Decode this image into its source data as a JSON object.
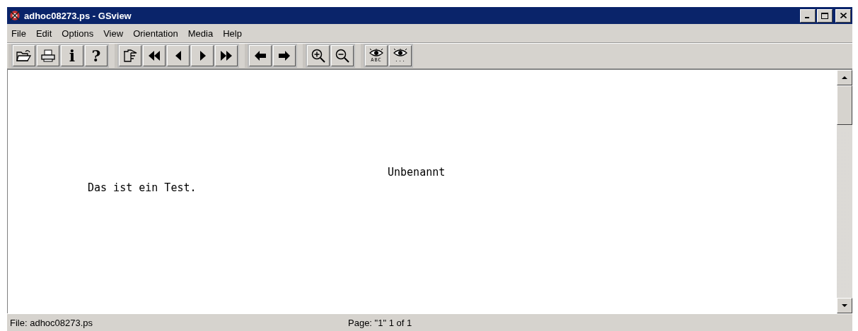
{
  "window": {
    "title": "adhoc08273.ps - GSview"
  },
  "menu": [
    "File",
    "Edit",
    "Options",
    "View",
    "Orientation",
    "Media",
    "Help"
  ],
  "toolbar": [
    [
      {
        "kind": "open"
      },
      {
        "kind": "print"
      },
      {
        "kind": "char",
        "label": "i"
      },
      {
        "kind": "char",
        "label": "?"
      }
    ],
    [
      {
        "kind": "hand"
      },
      {
        "kind": "first"
      },
      {
        "kind": "prev"
      },
      {
        "kind": "next"
      },
      {
        "kind": "last"
      }
    ],
    [
      {
        "kind": "back"
      },
      {
        "kind": "forward"
      }
    ],
    [
      {
        "kind": "zoomin"
      },
      {
        "kind": "zoomout"
      }
    ],
    [
      {
        "kind": "eye",
        "label": "ABC"
      },
      {
        "kind": "eye",
        "label": "..."
      }
    ]
  ],
  "document": {
    "texts": [
      "Unbenannt",
      "Das ist ein Test."
    ]
  },
  "status_bar": {
    "file": "File: adhoc08273.ps",
    "page": "Page: \"1\"  1 of 1"
  }
}
